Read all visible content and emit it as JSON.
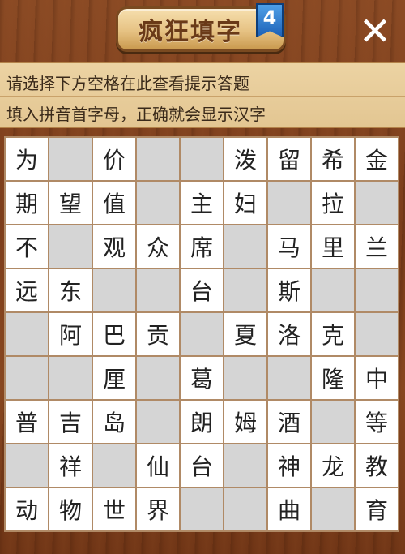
{
  "header": {
    "title": "疯狂填字",
    "level": "4",
    "close_label": "✕"
  },
  "hints": {
    "line1": "请选择下方空格在此查看提示答题",
    "line2": "填入拼音首字母，正确就会显示汉字"
  },
  "colors": {
    "white_cell": "#ffffff",
    "blocked_cell": "#d5d5d5",
    "grid_line": "#b08a66",
    "hint_panel": "#e3c692",
    "wood": "#7a3f1e"
  },
  "grid": {
    "rows": [
      [
        "为",
        null,
        "价",
        null,
        null,
        "泼",
        "留",
        "希",
        "金"
      ],
      [
        "期",
        "望",
        "值",
        null,
        "主",
        "妇",
        null,
        "拉",
        null
      ],
      [
        "不",
        null,
        "观",
        "众",
        "席",
        null,
        "马",
        "里",
        "兰"
      ],
      [
        "远",
        "东",
        null,
        null,
        "台",
        null,
        "斯",
        null,
        null
      ],
      [
        null,
        "阿",
        "巴",
        "贡",
        null,
        "夏",
        "洛",
        "克",
        null
      ],
      [
        null,
        null,
        "厘",
        null,
        "葛",
        null,
        null,
        "隆",
        "中"
      ],
      [
        "普",
        "吉",
        "岛",
        null,
        "朗",
        "姆",
        "酒",
        null,
        "等"
      ],
      [
        null,
        "祥",
        null,
        "仙",
        "台",
        null,
        "神",
        "龙",
        "教"
      ],
      [
        "动",
        "物",
        "世",
        "界",
        null,
        null,
        "曲",
        null,
        "育"
      ]
    ]
  }
}
